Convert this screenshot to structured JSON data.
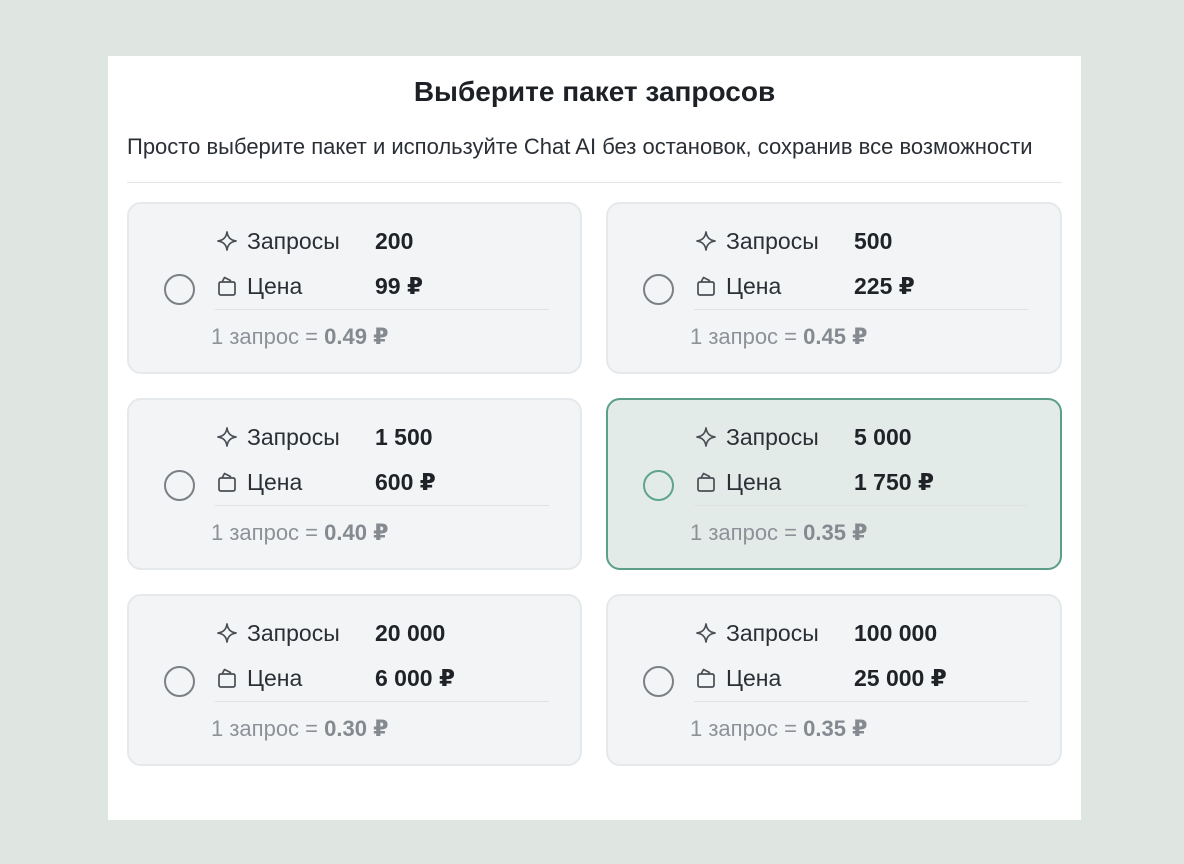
{
  "header": {
    "title": "Выберите пакет запросов",
    "subtitle": "Просто выберите пакет и используйте Chat AI без остановок, сохранив все возможности"
  },
  "labels": {
    "requests": "Запросы",
    "price": "Цена",
    "per_request": "1 запрос ="
  },
  "icons": {
    "requests": "sparkle-icon",
    "price": "bag-icon"
  },
  "colors": {
    "selected_border": "#5c9f88",
    "selected_bg": "#e3ebe8"
  },
  "packages": [
    {
      "requests": "200",
      "price": "99 ₽",
      "unit_price": "0.49 ₽",
      "selected": false
    },
    {
      "requests": "500",
      "price": "225 ₽",
      "unit_price": "0.45 ₽",
      "selected": false
    },
    {
      "requests": "1 500",
      "price": "600 ₽",
      "unit_price": "0.40 ₽",
      "selected": false
    },
    {
      "requests": "5 000",
      "price": "1 750 ₽",
      "unit_price": "0.35 ₽",
      "selected": true
    },
    {
      "requests": "20 000",
      "price": "6 000 ₽",
      "unit_price": "0.30 ₽",
      "selected": false
    },
    {
      "requests": "100 000",
      "price": "25 000 ₽",
      "unit_price": "0.35 ₽",
      "selected": false
    }
  ]
}
